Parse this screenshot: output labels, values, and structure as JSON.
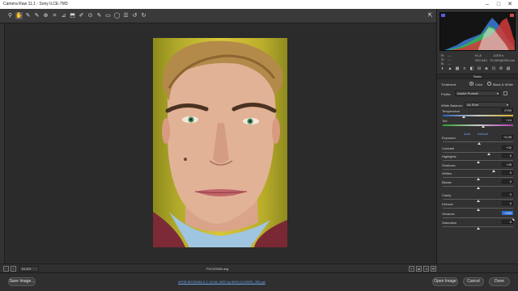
{
  "window": {
    "title": "Camera Raw 11.1 - Sony ILCE-7M3",
    "controls": [
      "–",
      "□",
      "✕"
    ]
  },
  "toolbar": {
    "tools": [
      {
        "name": "zoom-tool-icon",
        "glyph": "⚲"
      },
      {
        "name": "hand-tool-icon",
        "glyph": "✋",
        "active": true
      },
      {
        "name": "white-balance-tool-icon",
        "glyph": "✎"
      },
      {
        "name": "color-sampler-tool-icon",
        "glyph": "✎"
      },
      {
        "name": "targeted-adjustment-icon",
        "glyph": "⊕"
      },
      {
        "name": "crop-tool-icon",
        "glyph": "⌗"
      },
      {
        "name": "straighten-tool-icon",
        "glyph": "⊿"
      },
      {
        "name": "transform-tool-icon",
        "glyph": "⬒"
      },
      {
        "name": "spot-removal-icon",
        "glyph": "✐"
      },
      {
        "name": "red-eye-icon",
        "glyph": "⊙"
      },
      {
        "name": "adjustment-brush-icon",
        "glyph": "✎"
      },
      {
        "name": "graduated-filter-icon",
        "glyph": "▭"
      },
      {
        "name": "radial-filter-icon",
        "glyph": "◯"
      },
      {
        "name": "preferences-icon",
        "glyph": "☰"
      },
      {
        "name": "rotate-ccw-icon",
        "glyph": "↺"
      },
      {
        "name": "rotate-cw-icon",
        "glyph": "↻"
      }
    ],
    "filmstrip_icon": "⇱"
  },
  "histogram": {
    "readouts": {
      "r": "R:",
      "g": "G:",
      "b": "B:",
      "r_val": "---",
      "g_val": "---",
      "b_val": "---",
      "aperture": "f/1,8",
      "shutter": "1/200 s",
      "iso": "ISO 640",
      "lens": "70-200@200 mm"
    }
  },
  "panel_tabs": [
    "◐",
    "▲",
    "▦",
    "≡",
    "◧",
    "⊟",
    "◈",
    "⊡",
    "⚙",
    "▤"
  ],
  "basic": {
    "section_title": "Basic",
    "treatment_label": "Treatment:",
    "treatment_color": "Color",
    "treatment_bw": "Black & White",
    "profile_label": "Profile:",
    "profile_value": "Adobe Portrait",
    "wb_label": "White Balance:",
    "wb_value": "As Shot",
    "auto_label": "Auto",
    "default_label": "Default",
    "sliders": [
      {
        "label": "Temperature",
        "value": "2700",
        "pos": 0.3,
        "kind": "temp"
      },
      {
        "label": "Tint",
        "value": "+14",
        "pos": 0.57,
        "kind": "tint"
      },
      {
        "label": "Exposure",
        "value": "+0,35",
        "pos": 0.52
      },
      {
        "label": "Contrast",
        "value": "+32",
        "pos": 0.66
      },
      {
        "label": "Highlights",
        "value": "0",
        "pos": 0.5
      },
      {
        "label": "Shadows",
        "value": "+45",
        "pos": 0.72
      },
      {
        "label": "Whites",
        "value": "0",
        "pos": 0.5
      },
      {
        "label": "Blacks",
        "value": "0",
        "pos": 0.5
      },
      {
        "label": "Clarity",
        "value": "0",
        "pos": 0.5
      },
      {
        "label": "Dehaze",
        "value": "0",
        "pos": 0.5
      },
      {
        "label": "Vibrance",
        "value": "+100",
        "pos": 1.0,
        "highlight": true
      },
      {
        "label": "Saturation",
        "value": "0",
        "pos": 0.5
      }
    ]
  },
  "status_bar": {
    "zoom": "61,8%",
    "filename": "PXC00008.dng"
  },
  "footer": {
    "save_label": "Save Image...",
    "info_link": "sRGB IEC61966-2.1; 16 bit; 4000 by 6000 (24,0MP); 300 ppi",
    "open_label": "Open Image",
    "cancel_label": "Cancel",
    "done_label": "Done"
  },
  "colors": {
    "accent": "#2d6fd3",
    "link": "#6aa4e8"
  }
}
